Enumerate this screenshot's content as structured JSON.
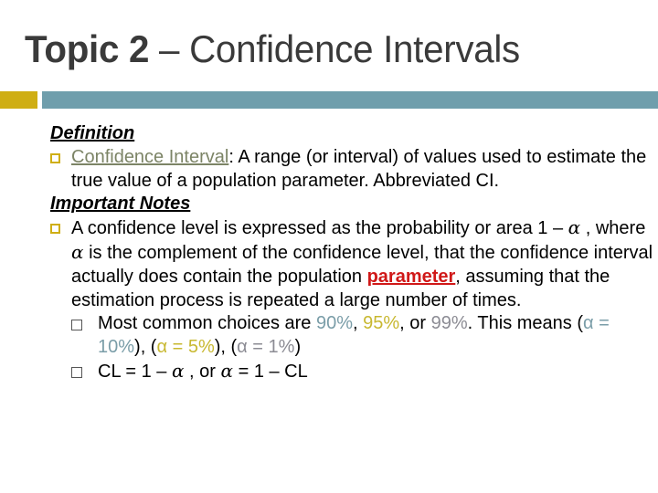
{
  "slide": {
    "title_bold": "Topic 2",
    "title_rest": " – Confidence Intervals",
    "colors": {
      "title": "#3a3a3a",
      "accent_gold": "#cfae14",
      "accent_bar": "#6f9eac",
      "link": "#7c8466",
      "emphasis_red": "#d01818",
      "pct_90": "#7a9da8",
      "pct_95": "#c8b830",
      "pct_99": "#8c8c94"
    }
  },
  "definition": {
    "heading": "Definition",
    "term": "Confidence Interval",
    "text": ": A range (or interval) of values used to estimate the true value of a population parameter. Abbreviated CI."
  },
  "notes": {
    "heading": "Important Notes",
    "p1_a": "A confidence level is expressed as the probability or area 1 – ",
    "alpha": "α",
    "p1_b": " , where ",
    "p1_c": " is the complement of the confidence level, that the confidence interval actually does contain the population ",
    "p1_emph": "parameter",
    "p1_d": ", assuming that the estimation process is repeated a large number of times.",
    "sub1_a": "Most common choices are ",
    "pct90": "90%",
    "comma1": ", ",
    "pct95": "95%",
    "or_text": ", or ",
    "pct99": "99%",
    "sub1_b": ".  This means (",
    "a10": "α = 10%",
    "sep1": "), (",
    "a5": "α = 5%",
    "sep2": "), (",
    "a1": "α = 1%",
    "close": ")",
    "sub2_a": "CL = 1 – ",
    "sub2_b": " ,  or  ",
    "sub2_c": " = 1 – CL"
  }
}
